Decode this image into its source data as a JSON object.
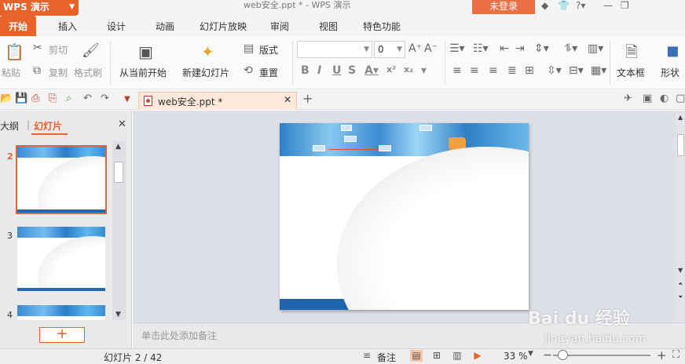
{
  "app": {
    "name": "WPS 演示",
    "window_title": "web安全.ppt * - WPS 演示",
    "login_label": "未登录"
  },
  "titlebar_icons": [
    "shirt-icon",
    "help-icon",
    "minimize-icon",
    "restore-icon"
  ],
  "tabs": [
    {
      "label": "开始",
      "active": true
    },
    {
      "label": "插入"
    },
    {
      "label": "设计"
    },
    {
      "label": "动画"
    },
    {
      "label": "幻灯片放映"
    },
    {
      "label": "审阅"
    },
    {
      "label": "视图"
    },
    {
      "label": "特色功能"
    }
  ],
  "ribbon": {
    "paste": "粘贴",
    "cut": "剪切",
    "copy": "复制",
    "format_painter": "格式刷",
    "from_current": "从当前开始",
    "new_slide": "新建幻灯片",
    "layout": "版式",
    "reset": "重置",
    "font_size": "0",
    "textbox": "文本框",
    "shape": "形状"
  },
  "document_tab": {
    "name": "web安全.ppt *"
  },
  "panel": {
    "tab_outline": "大纲",
    "tab_slides": "幻灯片",
    "separator": "|"
  },
  "slides": [
    {
      "number": "2",
      "selected": true
    },
    {
      "number": "3",
      "selected": false
    },
    {
      "number": "4",
      "selected": false
    }
  ],
  "notes": {
    "placeholder": "单击此处添加备注"
  },
  "status": {
    "slide_indicator": "幻灯片 2 / 42",
    "notes_label": "备注",
    "zoom": "33 %",
    "zoom_fraction": 0.33
  },
  "watermark": {
    "brand": "Bai du 经验",
    "url": "jingyan.baidu.com"
  },
  "colors": {
    "accent": "#e8622a",
    "slide_footer": "#1f63ad"
  }
}
